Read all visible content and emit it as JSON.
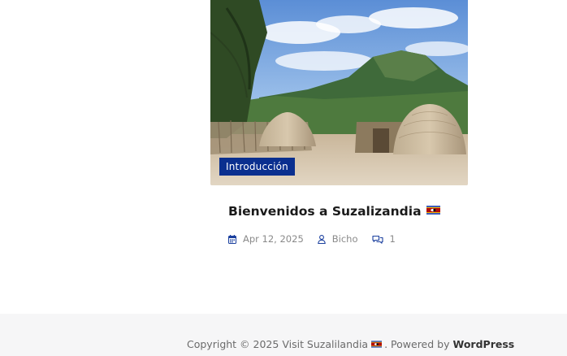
{
  "post": {
    "category": "Introducción",
    "title": "Bienvenidos a Suzalizandia",
    "date": "Apr 12, 2025",
    "author": "Bicho",
    "comments": "1",
    "image_icon": "swazi-village-photo",
    "title_flag_icon": "eswatini-flag-icon"
  },
  "footer": {
    "copyright": "Copyright © 2025",
    "site_name": "Visit Suzalilandia",
    "powered_by": ". Powered by",
    "platform": "WordPress"
  },
  "colors": {
    "category_bg": "#0a2f8f",
    "accent_icon": "#1a3f9e",
    "footer_bg": "#f6f6f7",
    "meta_text": "#8a8a8a"
  }
}
